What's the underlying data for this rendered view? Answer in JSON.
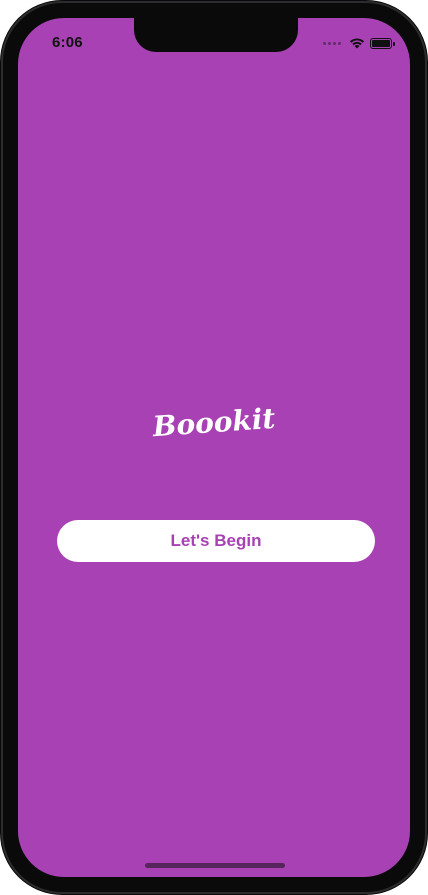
{
  "status_bar": {
    "time": "6:06",
    "icons": [
      "signal-dots-icon",
      "wifi-icon",
      "battery-icon"
    ]
  },
  "splash": {
    "logo_text": "Boookit",
    "button_label": "Let's Begin"
  },
  "colors": {
    "background": "#a841b3",
    "button_bg": "#ffffff",
    "button_text": "#a841b3",
    "device_frame": "#0a0a0a"
  }
}
